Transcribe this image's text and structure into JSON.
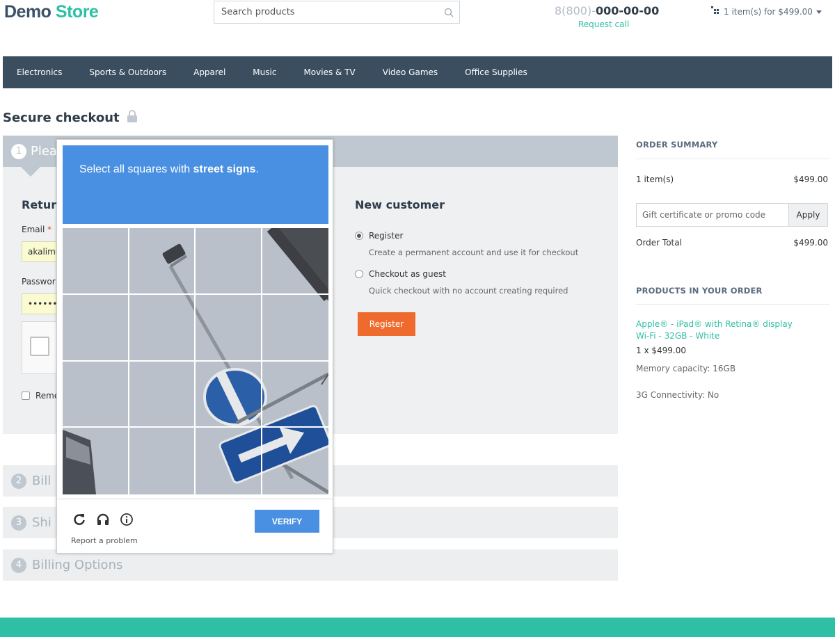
{
  "header": {
    "logo_part1": "Demo",
    "logo_part2": "Store",
    "search_placeholder": "Search products",
    "phone_prefix": "8(800)-",
    "phone_number": "000-00-00",
    "request_call": "Request call",
    "cart_label": "1 item(s) for $499.00"
  },
  "nav": [
    "Electronics",
    "Sports & Outdoors",
    "Apparel",
    "Music",
    "Movies & TV",
    "Video Games",
    "Office Supplies"
  ],
  "page_title": "Secure checkout",
  "step1": {
    "num": "1",
    "title": "Plea",
    "returning_title": "Retur",
    "email_label": "Email",
    "email_required": "*",
    "email_value": "akalimu",
    "password_label": "Passwor",
    "password_value": "••••••",
    "remember_label": "Reme",
    "new_customer_title": "New customer",
    "register_option": "Register",
    "register_desc": "Create a permanent account and use it for checkout",
    "guest_option": "Checkout as guest",
    "guest_desc": "Quick checkout with no account creating required",
    "register_button": "Register"
  },
  "steps": [
    {
      "num": "2",
      "title": "Bill"
    },
    {
      "num": "3",
      "title": "Shi"
    },
    {
      "num": "4",
      "title": "Billing Options"
    }
  ],
  "sidebar": {
    "order_summary": "ORDER SUMMARY",
    "items_label": "1 item(s)",
    "items_value": "$499.00",
    "promo_placeholder": "Gift certificate or promo code",
    "apply": "Apply",
    "order_total_label": "Order Total",
    "order_total_value": "$499.00",
    "products_heading": "PRODUCTS IN YOUR ORDER",
    "product_name": "Apple® - iPad® with Retina® display Wi-Fi - 32GB - White",
    "product_qty": "1 x $499.00",
    "option1": "Memory capacity: 16GB",
    "option2": "3G Connectivity: No"
  },
  "captcha": {
    "instruction_prefix": "Select all squares with ",
    "instruction_target": "street signs",
    "instruction_suffix": ".",
    "verify": "VERIFY",
    "report": "Report a problem",
    "icons": [
      "reload-icon",
      "headphones-icon",
      "info-icon"
    ]
  },
  "colors": {
    "brand": "#2ebfa5",
    "nav_bg": "#3a4e60",
    "register_btn": "#ef6a2d",
    "captcha_blue": "#4a90e2"
  }
}
